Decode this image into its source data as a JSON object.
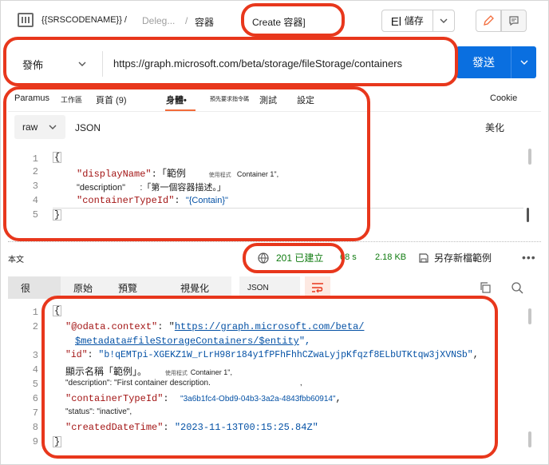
{
  "header": {
    "breadcrumb_root": "{{SRSCODENAME}} /",
    "breadcrumb_mid": "Deleg...",
    "breadcrumb_sep": "/",
    "breadcrumb_item": "容器",
    "request_name": "Create 容器]",
    "save_prefix": "El",
    "save_label": "儲存"
  },
  "request": {
    "method": "發佈",
    "url": "https://graph.microsoft.com/beta/storage/fileStorage/containers",
    "send_label": "發送",
    "tabs": [
      "Paramus",
      "工作區",
      "頁首 (9)",
      "身體•",
      "預先要求指令碼",
      "測試",
      "設定"
    ],
    "cookies_label": "Cookie",
    "body_mode": "raw",
    "body_format": "JSON",
    "beautify_label": "美化",
    "body_lines": {
      "n1": "1",
      "n2": "2",
      "n3": "3",
      "n4": "4",
      "n5": "5",
      "l1": "{",
      "l2_key": "\"displayName\"",
      "l2_val": "「範例",
      "l2_tiny": "使用程式",
      "l2_rest": "Container 1\",",
      "l3_key": "\"description\"",
      "l3_val": "「第一個容器描述。」",
      "l4_key": "\"containerTypeId\"",
      "l4_val": "\"{Contain}\"",
      "l5": "}"
    }
  },
  "response": {
    "label": "本文",
    "status": "201 已建立",
    "time": "68 s",
    "size": "2.18 KB",
    "save_example": "另存新檔範例",
    "more": "•••",
    "tabs": [
      "很",
      "原始",
      "預覽",
      "視覺化"
    ],
    "format": "JSON",
    "lines": {
      "n1": "1",
      "n2": "2",
      "n3": "3",
      "n4": "4",
      "n5": "5",
      "n6": "6",
      "n7": "7",
      "n8": "8",
      "n9": "9",
      "l1": "{",
      "l2_key": "\"@odata.context\"",
      "l2_url_a": "https://graph.microsoft.com/beta/",
      "l2_url_b": "$metadata#fileStorageContainers/$entity",
      "l3_key": "\"id\"",
      "l3_val": "\"b!qEMTpi-XGEKZ1W_rLrH98r184y1fPFhFhhCZwaLyjpKfqzf8ELbUTKtqw3jXVNSb\"",
      "l4_text": "顯示名稱「範例」。",
      "l4_tiny": "使用程式",
      "l4_rest": "Container 1\",",
      "l5_key": "\"description\"",
      "l5_val": "\"First container description.",
      "l5_comma": ",",
      "l6_key": "\"containerTypeId\"",
      "l6_val": "\"3a6b1fc4-Obd9-04b3-3a2a-4843fbb60914\"",
      "l7_key": "\"status\"",
      "l7_val": "\"inactive\",",
      "l8_key": "\"createdDateTime\"",
      "l8_val": "\"2023-11-13T00:15:25.84Z\"",
      "l9": "}"
    }
  },
  "colors": {
    "accent": "#0a6fe0",
    "annotation": "#e8371c",
    "tab_underline": "#f26b3a",
    "status_ok": "#0f7b0f"
  }
}
